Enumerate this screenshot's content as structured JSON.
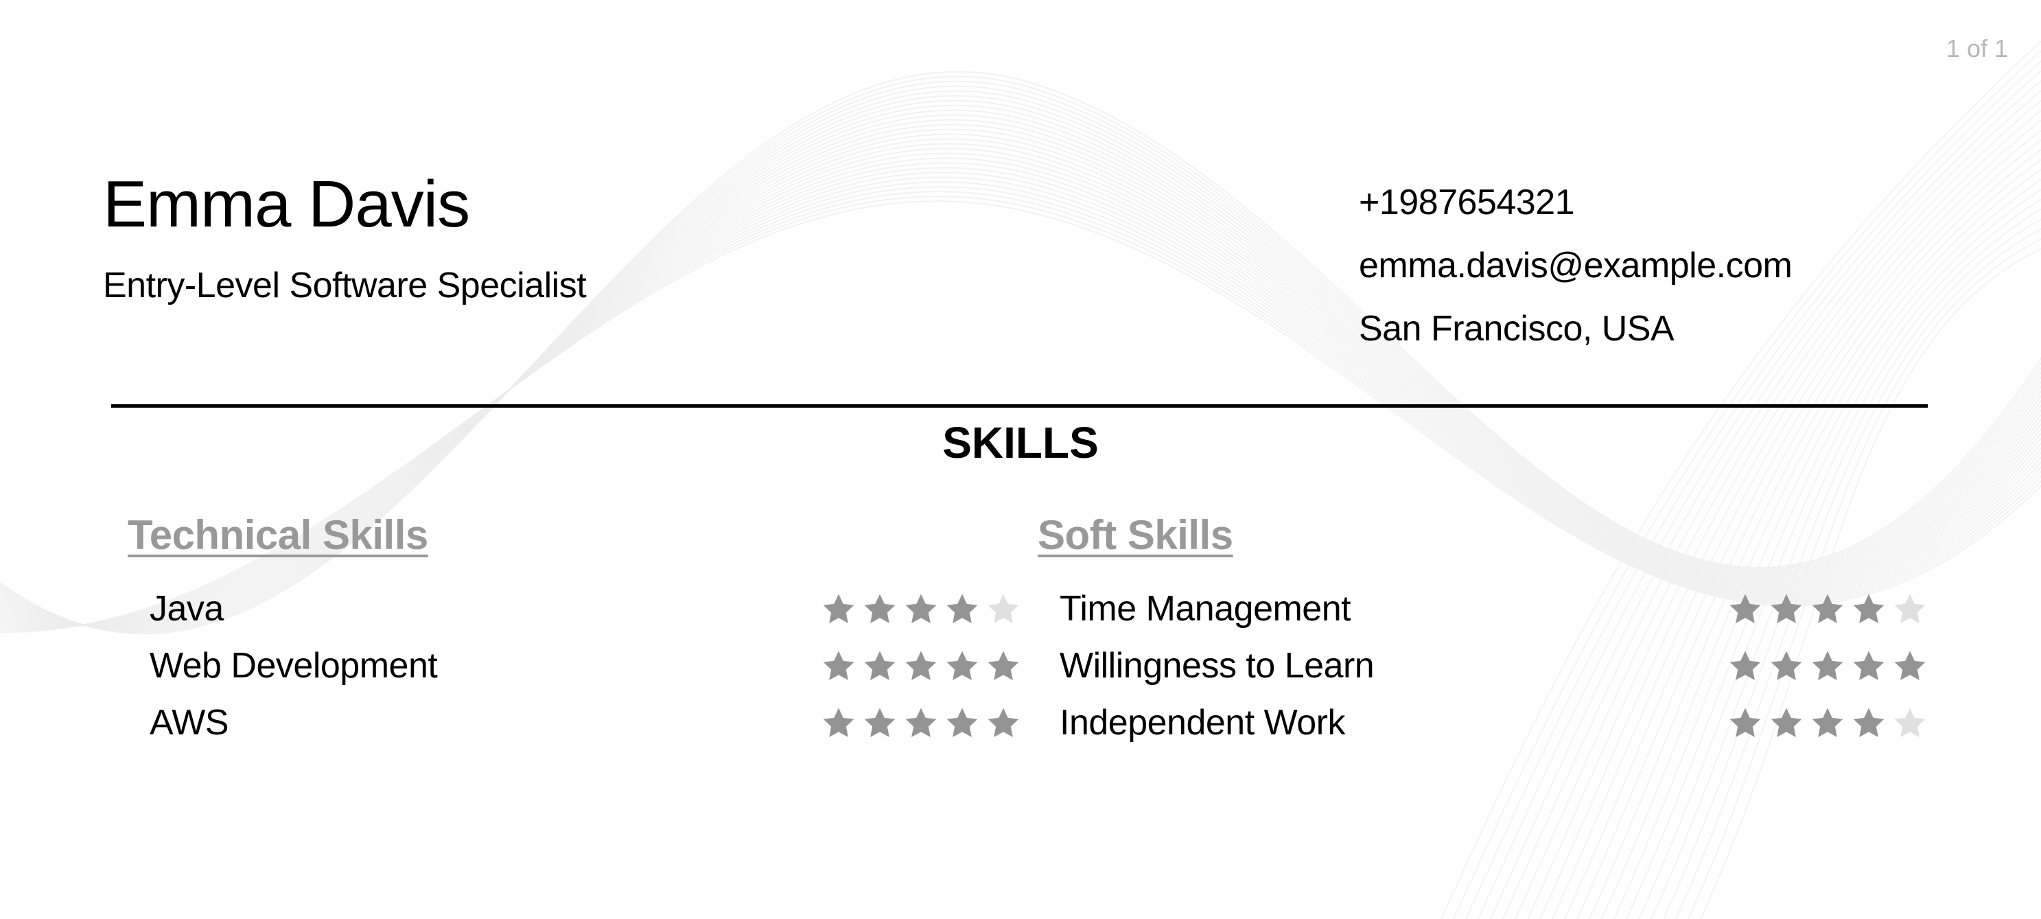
{
  "page_indicator": "1 of 1",
  "header": {
    "name": "Emma Davis",
    "title": "Entry-Level Software Specialist"
  },
  "contact": {
    "phone": "+1987654321",
    "email": "emma.davis@example.com",
    "location": "San Francisco, USA"
  },
  "skills_section": {
    "title": "SKILLS",
    "max_rating": 5,
    "colors": {
      "star_filled": "#949494",
      "star_empty": "#e0e0e0",
      "group_heading": "#999999"
    },
    "groups": [
      {
        "heading": "Technical Skills",
        "items": [
          {
            "name": "Java",
            "rating": 4
          },
          {
            "name": "Web Development",
            "rating": 5
          },
          {
            "name": "AWS",
            "rating": 5
          }
        ]
      },
      {
        "heading": "Soft Skills",
        "items": [
          {
            "name": "Time Management",
            "rating": 4
          },
          {
            "name": "Willingness to Learn",
            "rating": 5
          },
          {
            "name": "Independent Work",
            "rating": 4
          }
        ]
      }
    ]
  }
}
